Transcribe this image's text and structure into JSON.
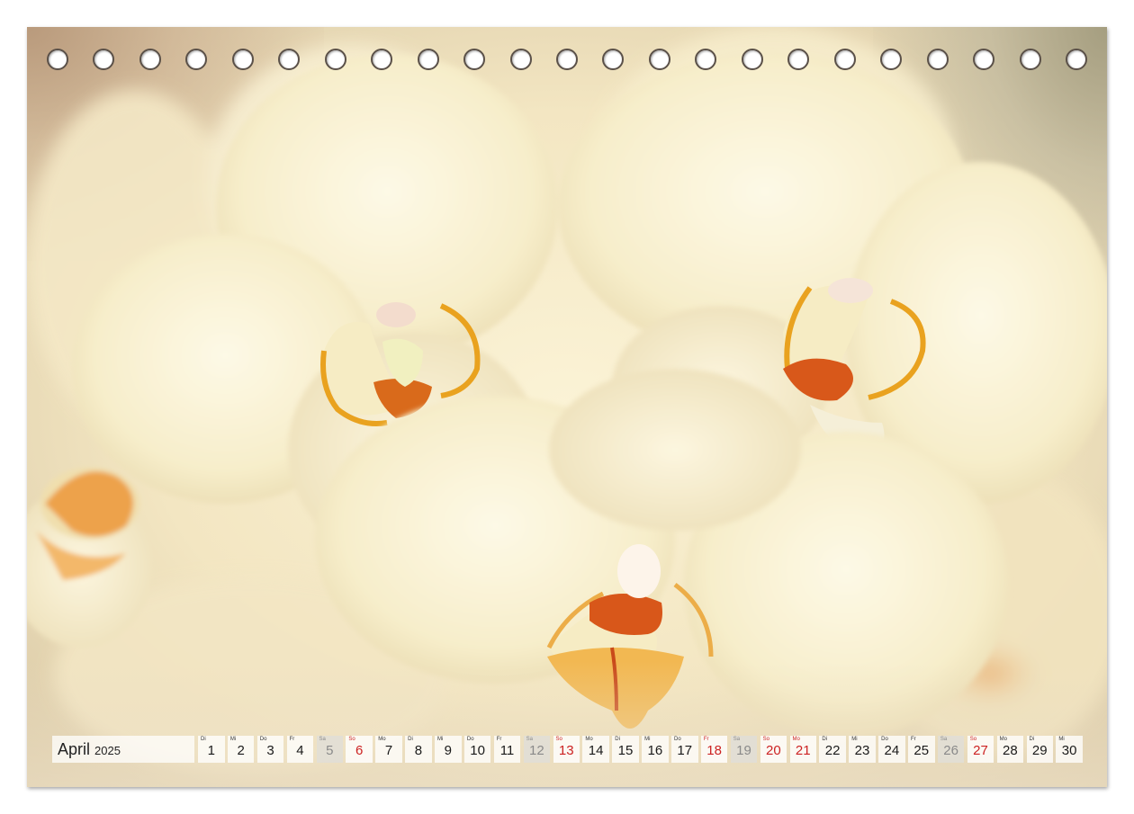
{
  "calendar": {
    "month": "April",
    "year": "2025",
    "days": [
      {
        "wd": "Di",
        "n": "1",
        "type": "weekday"
      },
      {
        "wd": "Mi",
        "n": "2",
        "type": "weekday"
      },
      {
        "wd": "Do",
        "n": "3",
        "type": "weekday"
      },
      {
        "wd": "Fr",
        "n": "4",
        "type": "weekday"
      },
      {
        "wd": "Sa",
        "n": "5",
        "type": "sat"
      },
      {
        "wd": "So",
        "n": "6",
        "type": "sun"
      },
      {
        "wd": "Mo",
        "n": "7",
        "type": "weekday"
      },
      {
        "wd": "Di",
        "n": "8",
        "type": "weekday"
      },
      {
        "wd": "Mi",
        "n": "9",
        "type": "weekday"
      },
      {
        "wd": "Do",
        "n": "10",
        "type": "weekday"
      },
      {
        "wd": "Fr",
        "n": "11",
        "type": "weekday"
      },
      {
        "wd": "Sa",
        "n": "12",
        "type": "sat"
      },
      {
        "wd": "So",
        "n": "13",
        "type": "sun"
      },
      {
        "wd": "Mo",
        "n": "14",
        "type": "weekday"
      },
      {
        "wd": "Di",
        "n": "15",
        "type": "weekday"
      },
      {
        "wd": "Mi",
        "n": "16",
        "type": "weekday"
      },
      {
        "wd": "Do",
        "n": "17",
        "type": "weekday"
      },
      {
        "wd": "Fr",
        "n": "18",
        "type": "sun"
      },
      {
        "wd": "Sa",
        "n": "19",
        "type": "sat"
      },
      {
        "wd": "So",
        "n": "20",
        "type": "sun"
      },
      {
        "wd": "Mo",
        "n": "21",
        "type": "sun"
      },
      {
        "wd": "Di",
        "n": "22",
        "type": "weekday"
      },
      {
        "wd": "Mi",
        "n": "23",
        "type": "weekday"
      },
      {
        "wd": "Do",
        "n": "24",
        "type": "weekday"
      },
      {
        "wd": "Fr",
        "n": "25",
        "type": "weekday"
      },
      {
        "wd": "Sa",
        "n": "26",
        "type": "sat"
      },
      {
        "wd": "So",
        "n": "27",
        "type": "sun"
      },
      {
        "wd": "Mo",
        "n": "28",
        "type": "weekday"
      },
      {
        "wd": "Di",
        "n": "29",
        "type": "weekday"
      },
      {
        "wd": "Mi",
        "n": "30",
        "type": "weekday"
      }
    ]
  },
  "binding": {
    "hole_count": 23
  },
  "colors": {
    "petal": "#fbf5dc",
    "petal_shade": "#efe3bd",
    "lip_orange": "#e8931f",
    "lip_red": "#c94a1a",
    "sunday_red": "#cc2222",
    "saturday_grey": "#8a8a8a"
  }
}
